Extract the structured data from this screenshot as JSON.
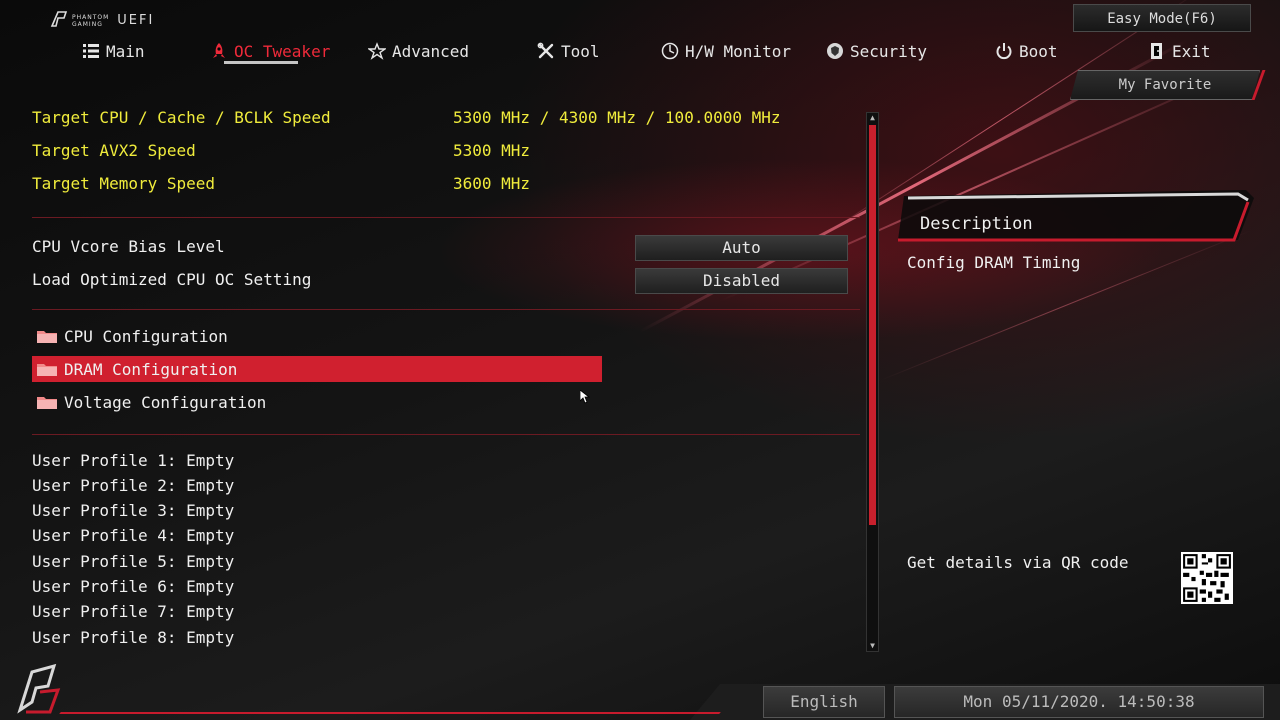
{
  "brand": {
    "line1": "PHANTOM",
    "line2": "GAMING",
    "uefi": "UEFI"
  },
  "header": {
    "easy_mode": "Easy Mode(F6)",
    "my_favorite": "My Favorite"
  },
  "nav": {
    "tabs": [
      {
        "label": "Main",
        "icon": "list-icon"
      },
      {
        "label": "OC Tweaker",
        "icon": "rocket-icon",
        "active": true
      },
      {
        "label": "Advanced",
        "icon": "star-icon"
      },
      {
        "label": "Tool",
        "icon": "tools-icon"
      },
      {
        "label": "H/W Monitor",
        "icon": "monitor-icon"
      },
      {
        "label": "Security",
        "icon": "shield-icon"
      },
      {
        "label": "Boot",
        "icon": "power-icon"
      },
      {
        "label": "Exit",
        "icon": "exit-icon"
      }
    ]
  },
  "targets": [
    {
      "label": "Target CPU / Cache / BCLK Speed",
      "value": "5300 MHz / 4300 MHz / 100.0000 MHz"
    },
    {
      "label": "Target AVX2 Speed",
      "value": "5300 MHz"
    },
    {
      "label": "Target Memory Speed",
      "value": "3600 MHz"
    }
  ],
  "settings": [
    {
      "label": "CPU Vcore Bias Level",
      "value": "Auto"
    },
    {
      "label": "Load Optimized CPU OC Setting",
      "value": "Disabled"
    }
  ],
  "menus": [
    {
      "label": "CPU Configuration",
      "selected": false
    },
    {
      "label": "DRAM Configuration",
      "selected": true
    },
    {
      "label": "Voltage Configuration",
      "selected": false
    }
  ],
  "profiles": [
    "User Profile 1: Empty",
    "User Profile 2: Empty",
    "User Profile 3: Empty",
    "User Profile 4: Empty",
    "User Profile 5: Empty",
    "User Profile 6: Empty",
    "User Profile 7: Empty",
    "User Profile 8: Empty"
  ],
  "description": {
    "title": "Description",
    "text": "Config DRAM Timing",
    "qr_label": "Get details via QR code"
  },
  "footer": {
    "language": "English",
    "datetime": "Mon 05/11/2020. 14:50:38"
  },
  "colors": {
    "accent": "#d0202f",
    "target_text": "#f0ec3c",
    "active_tab": "#ef2a3a"
  }
}
